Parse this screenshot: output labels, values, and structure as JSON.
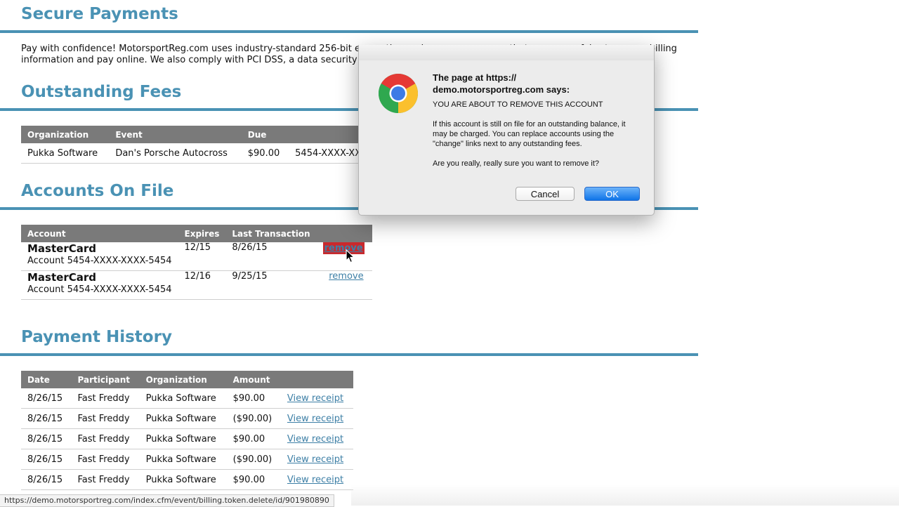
{
  "sections": {
    "secure": {
      "title": "Secure Payments",
      "text": "Pay with confidence! MotorsportReg.com uses industry-standard 256-bit encryption and secure servers so that you can safely store your billing information and pay online. We also comply with PCI DSS, a data security standard of more than 200 requirements."
    },
    "fees": {
      "title": "Outstanding Fees"
    },
    "accounts": {
      "title": "Accounts On File"
    },
    "history": {
      "title": "Payment History"
    }
  },
  "fees_table": {
    "headers": [
      "Organization",
      "Event",
      "Due",
      ""
    ],
    "row": {
      "organization": "Pukka Software",
      "event": "Dan's Porsche Autocross",
      "due": "$90.00",
      "account": "5454-XXXX-XX"
    }
  },
  "accounts_table": {
    "headers": [
      "Account",
      "Expires",
      "Last Transaction",
      ""
    ],
    "rows": [
      {
        "brand": "MasterCard",
        "number": "Account 5454-XXXX-XXXX-5454",
        "expires": "12/15",
        "last": "8/26/15",
        "action": "remove"
      },
      {
        "brand": "MasterCard",
        "number": "Account 5454-XXXX-XXXX-5454",
        "expires": "12/16",
        "last": "9/25/15",
        "action": "remove"
      }
    ]
  },
  "history_table": {
    "headers": [
      "Date",
      "Participant",
      "Organization",
      "Amount",
      ""
    ],
    "rows": [
      {
        "date": "8/26/15",
        "participant": "Fast Freddy",
        "organization": "Pukka Software",
        "amount": "$90.00",
        "link": "View receipt"
      },
      {
        "date": "8/26/15",
        "participant": "Fast Freddy",
        "organization": "Pukka Software",
        "amount": "($90.00)",
        "link": "View receipt"
      },
      {
        "date": "8/26/15",
        "participant": "Fast Freddy",
        "organization": "Pukka Software",
        "amount": "$90.00",
        "link": "View receipt"
      },
      {
        "date": "8/26/15",
        "participant": "Fast Freddy",
        "organization": "Pukka Software",
        "amount": "($90.00)",
        "link": "View receipt"
      },
      {
        "date": "8/26/15",
        "participant": "Fast Freddy",
        "organization": "Pukka Software",
        "amount": "$90.00",
        "link": "View receipt"
      }
    ]
  },
  "dialog": {
    "heading": "The page at https://\ndemo.motorsportreg.com says:",
    "message": "YOU ARE ABOUT TO REMOVE THIS ACCOUNT\n\nIf this account is still on file for an outstanding balance, it may be charged.  You can replace accounts using the \"change\" links next to any outstanding fees.\n\nAre you really, really sure you want to remove it?",
    "cancel_label": "Cancel",
    "ok_label": "OK",
    "icon": "chrome-logo-icon"
  },
  "status_bar": "https://demo.motorsportreg.com/index.cfm/event/billing.token.delete/id/901980890",
  "colors": {
    "accent": "#4a92b4",
    "header_bg": "#7a7a7a",
    "remove_active": "#c9292d",
    "link": "#3d7fa6",
    "ok_button": "#1a7cf0"
  }
}
